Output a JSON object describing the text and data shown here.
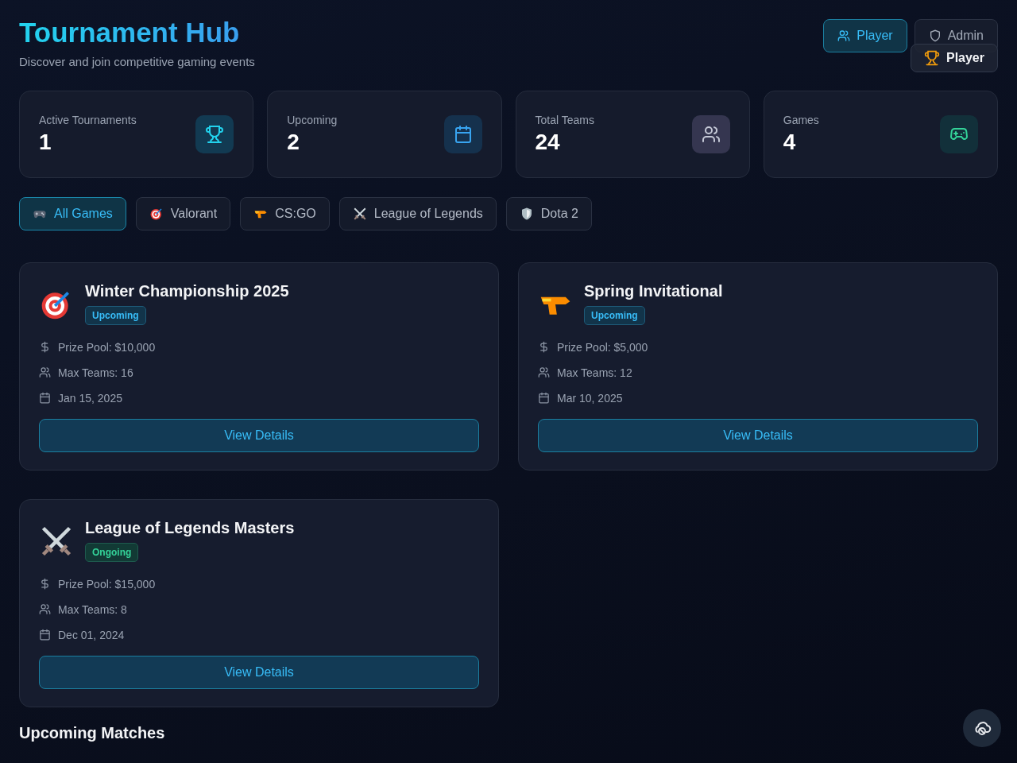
{
  "header": {
    "title": "Tournament Hub",
    "subtitle": "Discover and join competitive gaming events"
  },
  "role_buttons": [
    {
      "label": "Player",
      "kind": "users",
      "selected": true
    },
    {
      "label": "Admin",
      "kind": "shield",
      "selected": false
    }
  ],
  "role_overlay": {
    "label": "Player",
    "kind": "trophy"
  },
  "stats": [
    {
      "label": "Active Tournaments",
      "value": "1",
      "kind": "trophy"
    },
    {
      "label": "Upcoming",
      "value": "2",
      "kind": "calendar"
    },
    {
      "label": "Total Teams",
      "value": "24",
      "kind": "users"
    },
    {
      "label": "Games",
      "value": "4",
      "kind": "gamepad"
    }
  ],
  "filters": [
    {
      "label": "All Games",
      "kind": "gamepad",
      "selected": true
    },
    {
      "label": "Valorant",
      "kind": "target",
      "selected": false
    },
    {
      "label": "CS:GO",
      "kind": "gun",
      "selected": false
    },
    {
      "label": "League of Legends",
      "kind": "swords",
      "selected": false
    },
    {
      "label": "Dota 2",
      "kind": "shield",
      "selected": false
    }
  ],
  "tournaments": [
    {
      "title": "Winter Championship 2025",
      "kind": "target",
      "status": {
        "label": "Upcoming",
        "kind": "upcoming"
      },
      "prize": "Prize Pool: $10,000",
      "teams": "Max Teams: 16",
      "date": "Jan 15, 2025",
      "button": "View Details"
    },
    {
      "title": "Spring Invitational",
      "kind": "gun",
      "status": {
        "label": "Upcoming",
        "kind": "upcoming"
      },
      "prize": "Prize Pool: $5,000",
      "teams": "Max Teams: 12",
      "date": "Mar 10, 2025",
      "button": "View Details"
    },
    {
      "title": "League of Legends Masters",
      "kind": "swords",
      "status": {
        "label": "Ongoing",
        "kind": "ongoing"
      },
      "prize": "Prize Pool: $15,000",
      "teams": "Max Teams: 8",
      "date": "Dec 01, 2024",
      "button": "View Details"
    }
  ],
  "section_title": "Upcoming Matches"
}
